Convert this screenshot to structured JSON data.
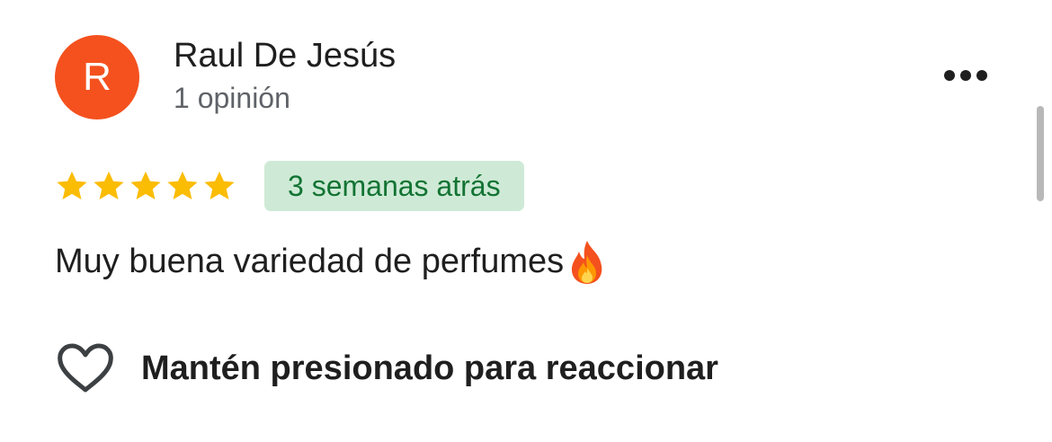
{
  "review": {
    "avatar_letter": "R",
    "reviewer_name": "Raul De Jesús",
    "reviewer_count": "1 opinión",
    "rating": 5,
    "rating_max": 5,
    "time_ago": "3 semanas atrás",
    "text": "Muy buena variedad de perfumes",
    "emoji_icon": "fire-emoji-icon"
  },
  "actions": {
    "more_icon": "more-horizontal-icon",
    "react_icon": "heart-outline-icon",
    "react_label": "Mantén presionado para reaccionar"
  },
  "colors": {
    "avatar_bg": "#f4511e",
    "star": "#fbbc04",
    "badge_bg": "#ceead6",
    "badge_text": "#137333",
    "text_primary": "#1f1f1f",
    "text_secondary": "#5f6368"
  }
}
